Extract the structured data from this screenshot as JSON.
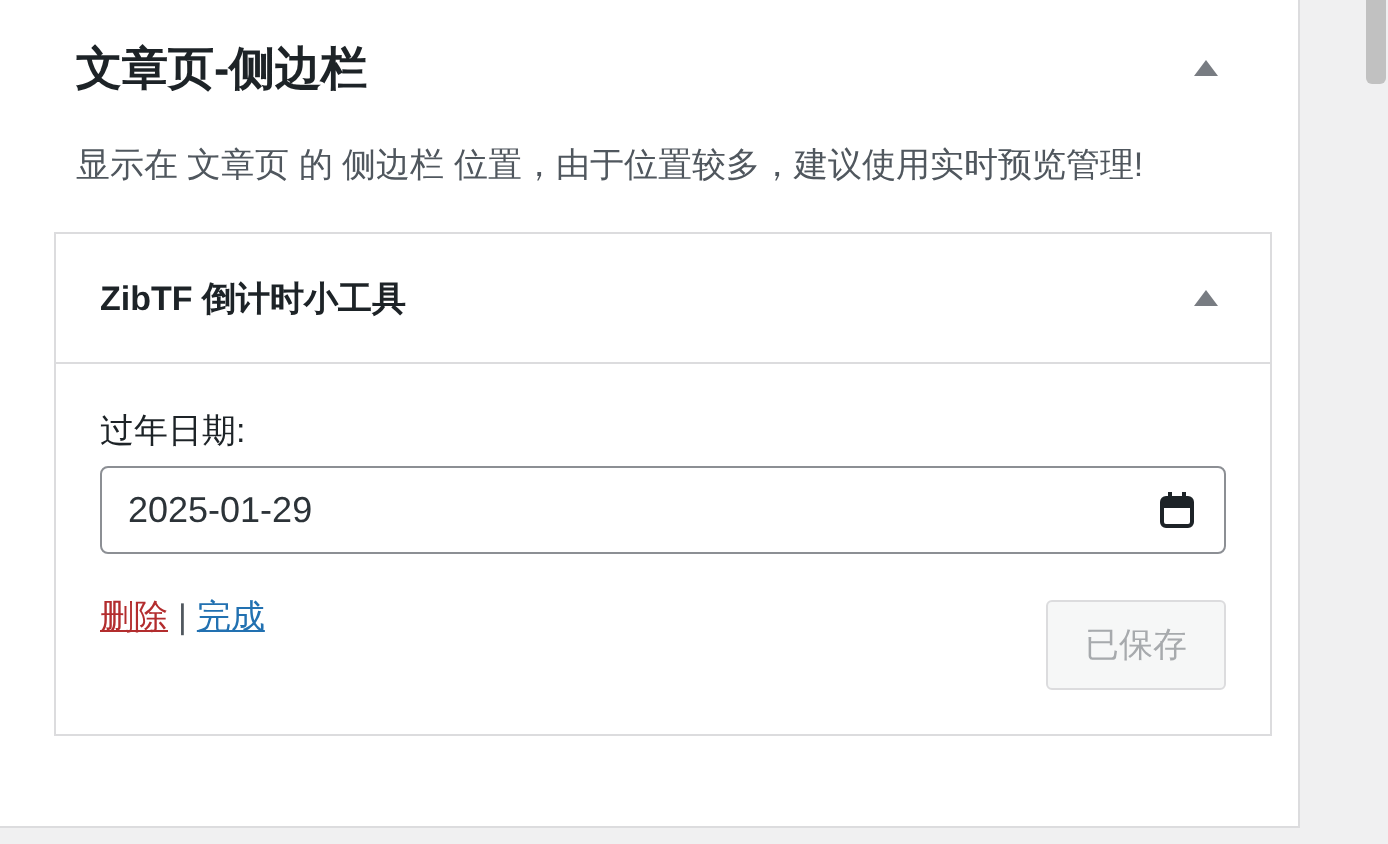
{
  "section": {
    "title": "文章页-侧边栏",
    "expanded": true,
    "description": "显示在 文章页 的 侧边栏 位置，由于位置较多，建议使用实时预览管理!"
  },
  "widget": {
    "title": "ZibTF 倒计时小工具",
    "expanded": true,
    "field": {
      "label": "过年日期:",
      "value": "2025-01-29"
    },
    "links": [
      {
        "label": "删除",
        "kind": "delete"
      },
      {
        "label": "完成",
        "kind": "done"
      }
    ],
    "separator": "|",
    "button": {
      "label": "已保存",
      "disabled": true
    }
  }
}
